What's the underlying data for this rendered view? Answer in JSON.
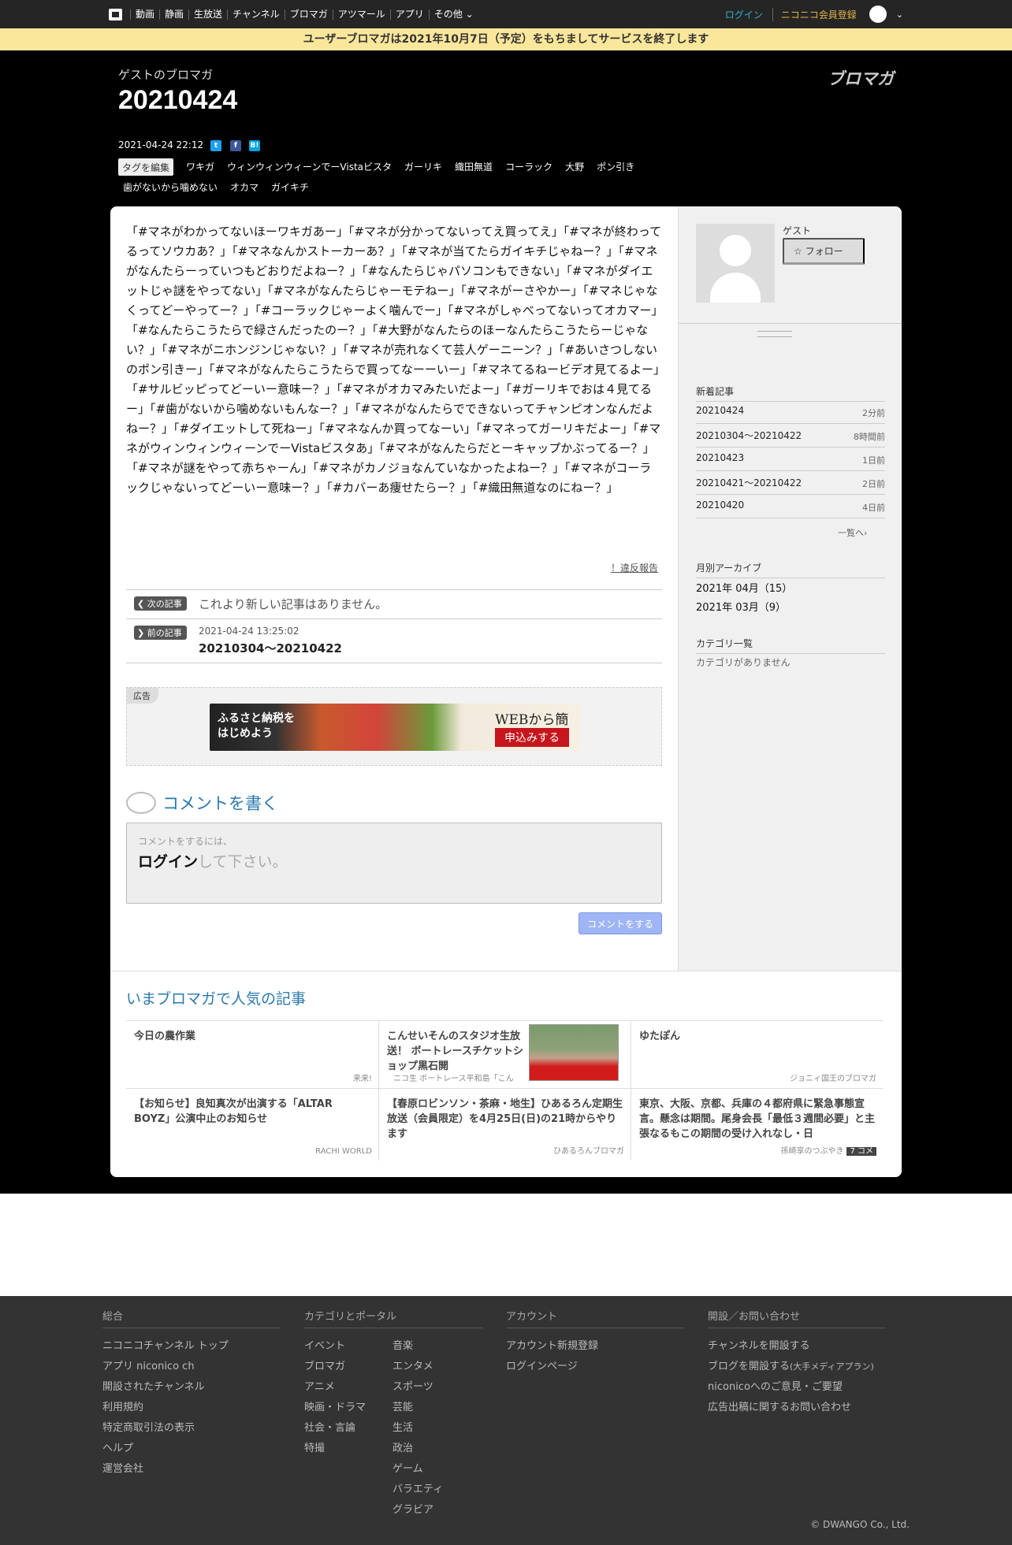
{
  "topnav": {
    "items": [
      "動画",
      "静画",
      "生放送",
      "チャンネル",
      "ブロマガ",
      "アツマール",
      "アプリ",
      "その他"
    ],
    "login": "ログイン",
    "register": "ニコニコ会員登録"
  },
  "notice": "ユーザーブロマガは2021年10月7日（予定）をもちましてサービスを終了します",
  "header": {
    "blog_name": "ゲストのブロマガ",
    "title": "20210424",
    "brand": "ブロマガ",
    "date": "2021-04-24 22:12",
    "share": [
      "t",
      "f",
      "B!"
    ]
  },
  "tags": {
    "edit_label": "タグを編集",
    "items": [
      "ワキガ",
      "ウィンウィンウィーンでーVistaビスタ",
      "ガーリキ",
      "織田無道",
      "コーラック",
      "大野",
      "ポン引き",
      "歯がないから噛めない",
      "オカマ",
      "ガイキチ"
    ]
  },
  "article": {
    "body": "「#マネがわかってないほーワキガあー」「#マネが分かってないってえ買ってえ」「#マネが終わってるってソウカあ？」「#マネなんかストーカーあ？」「#マネが当てたらガイキチじゃねー？」「#マネがなんたらーっていつもどおりだよねー？」「#なんたらじゃパソコンもできない」「#マネがダイエットじゃ謎をやってない」「#マネがなんたらじゃーモテねー」「#マネがーさやかー」「#マネじゃなくってどーやってー？」「#コーラックじゃーよく噛んでー」「#マネがしゃべってないってオカマー」「#なんたらこうたらで緑さんだったのー？」「#大野がなんたらのほーなんたらこうたらーじゃない？」「#マネがニホンジンじゃない？」「#マネが売れなくて芸人ゲーニーン？」「#あいさつしないのポン引きー」「#マネがなんたらこうたらで買ってなーーいー」「#マネてるねービデオ見てるよー」「#サルビッピってどーいー意味ー？」「#マネがオカマみたいだよー」「#ガーリキでおは４見てるー」「#歯がないから噛めないもんなー？」「#マネがなんたらでできないってチャンピオンなんだよねー？」「#ダイエットして死ねー」「#マネなんか買ってなーい」「#マネってガーリキだよー」「#マネがウィンウィンウィーンでーVistaビスタあ」「#マネがなんたらだとーキャップかぶってるー？」「#マネが謎をやって赤ちゃーん」「#マネがカノジョなんていなかったよねー？」「#マネがコーラックじゃないってどーいー意味ー？」「#カバーあ痩せたらー？」「#織田無道なのにねー？」",
    "report": "！違反報告"
  },
  "article_nav": {
    "next_label": "次の記事",
    "next_text": "これより新しい記事はありません。",
    "prev_label": "前の記事",
    "prev_date": "2021-04-24 13:25:02",
    "prev_title": "20210304～20210422"
  },
  "ad": {
    "label": "広告",
    "line1": "ふるさと納税を",
    "line2": "はじめよう",
    "web": "WEBから簡単",
    "cta": "申込みする"
  },
  "comment": {
    "title": "コメントを書く",
    "hint": "コメントをするには、",
    "login_word": "ログイン",
    "login_rest": "して下さい。",
    "submit": "コメントをする"
  },
  "sidebar": {
    "user_name": "ゲスト",
    "follow": "フォロー",
    "recent_heading": "新着記事",
    "recent": [
      {
        "title": "20210424",
        "age": "2分前"
      },
      {
        "title": "20210304～20210422",
        "age": "8時間前"
      },
      {
        "title": "20210423",
        "age": "1日前"
      },
      {
        "title": "20210421～20210422",
        "age": "2日前"
      },
      {
        "title": "20210420",
        "age": "4日前"
      }
    ],
    "recent_more": "一覧へ",
    "archive_heading": "月別アーカイブ",
    "archive": [
      "2021年 04月（15）",
      "2021年 03月（9）"
    ],
    "category_heading": "カテゴリ一覧",
    "category_empty": "カテゴリがありません"
  },
  "popular": {
    "heading": "いまブロマガで人気の記事",
    "items": [
      {
        "title": "今日の農作業",
        "source": "来来!"
      },
      {
        "title": "こんせいそんのスタジオ生放送！ ボートレースチケットショップ黒石開",
        "source": "ニコ生 ボートレース平和島「こん"
      },
      {
        "title": "ゆたぽん",
        "source": "ジョニィ国王のブロマガ"
      },
      {
        "title": "【お知らせ】良知真次が出演する「ALTAR BOYZ」公演中止のお知らせ",
        "source": "RACHI WORLD"
      },
      {
        "title": "【春原ロビンソン・茶麻・地生】ひあるろん定期生放送（会員限定）を4月25日(日)の21時からやります",
        "source": "ひあるろんブロマガ"
      },
      {
        "title": "東京、大阪、京都、兵庫の４都府県に緊急事態宣言。懸念は期間。尾身会長「最低３週間必要」と主張なるもこの期間の受け入れなし・日",
        "source": "孫崎享のつぶやき",
        "comments": "7 コメ"
      }
    ]
  },
  "footer": {
    "col1": {
      "heading": "総合",
      "links": [
        "ニコニコチャンネル トップ",
        "アプリ niconico ch",
        "開設されたチャンネル",
        "利用規約",
        "特定商取引法の表示",
        "ヘルプ",
        "運営会社"
      ]
    },
    "col2": {
      "heading": "カテゴリとポータル",
      "links_a": [
        "イベント",
        "ブロマガ",
        "アニメ",
        "映画・ドラマ",
        "社会・言論",
        "特撮"
      ],
      "links_b": [
        "音楽",
        "エンタメ",
        "スポーツ",
        "芸能",
        "生活",
        "政治",
        "ゲーム",
        "バラエティ",
        "グラビア"
      ]
    },
    "col3": {
      "heading": "アカウント",
      "links": [
        "アカウント新規登録",
        "ログインページ"
      ]
    },
    "col4": {
      "heading": "開設／お問い合わせ",
      "link1": "チャンネルを開設する",
      "link2": "ブログを開設する",
      "link2_small": "(大手メディアプラン)",
      "link3": "niconicoへのご意見・ご要望",
      "link4": "広告出稿に関するお問い合わせ"
    },
    "copyright": "© DWANGO Co., Ltd."
  }
}
